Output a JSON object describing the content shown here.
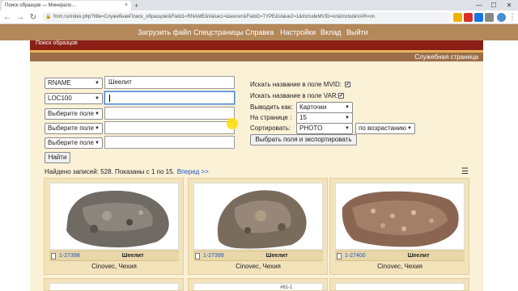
{
  "browser": {
    "tab_title": "Поиск образцов — Минерало…",
    "tab_close": "×",
    "new_tab": "+",
    "win_minimize": "—",
    "win_maximize": "☐",
    "win_close": "✕",
    "back": "←",
    "forward": "→",
    "reload": "↻",
    "lock": "🔒",
    "url": "fmm.ru/index.php?title=СлужебнаяПоиск_образцов/&Field1=RNAME&Value1=Шеелит&Field2=TYPE&Value2=1&IncludeMVID=on&IncludeVAR=on"
  },
  "nav": {
    "items": [
      "Загрузить файл",
      "Спецстраницы",
      "Справка",
      "Настройки",
      "Вклад",
      "Выйти"
    ],
    "color": "#b3885a"
  },
  "header": {
    "band_label": "Поиск образцов",
    "sub_label": "Служебная страница",
    "band_color": "#8b1f15"
  },
  "search": {
    "fields": [
      {
        "field": "RNAME",
        "value": "Шеелит"
      },
      {
        "field": "LOC100",
        "value": ""
      },
      {
        "field": "Выберите поле",
        "value": ""
      },
      {
        "field": "Выберите поле",
        "value": ""
      },
      {
        "field": "Выберите поле",
        "value": ""
      }
    ],
    "submit_label": "Найти"
  },
  "options": {
    "mvid_label": "Искать название в поле MVID:",
    "mvid_checked": "✔",
    "var_label": "Искать название в поле VAR:",
    "var_checked": "✔",
    "output_label": "Выводить как:",
    "output_value": "Карточки",
    "per_page_label": "На странице :",
    "per_page_value": "15",
    "sort_label": "Сортировать:",
    "sort_value": "PHOTO",
    "sort_order": "по возрастанию",
    "export_label": "Выбрать поля и экспортировать"
  },
  "results": {
    "summary": "Найдено записей: 528. Показаны с 1 по 15.",
    "next_link": "Вперед >>",
    "menu_icon": "☰"
  },
  "cards": [
    {
      "id": "1-27398",
      "mineral": "Шеелит",
      "locality": "Cinovec, Чехия"
    },
    {
      "id": "1-27399",
      "mineral": "Шеелит",
      "locality": "Cinovec, Чехия"
    },
    {
      "id": "1-27400",
      "mineral": "Шеелит",
      "locality": "Cinovec, Чехия"
    }
  ],
  "second_row_label": "#61-1"
}
